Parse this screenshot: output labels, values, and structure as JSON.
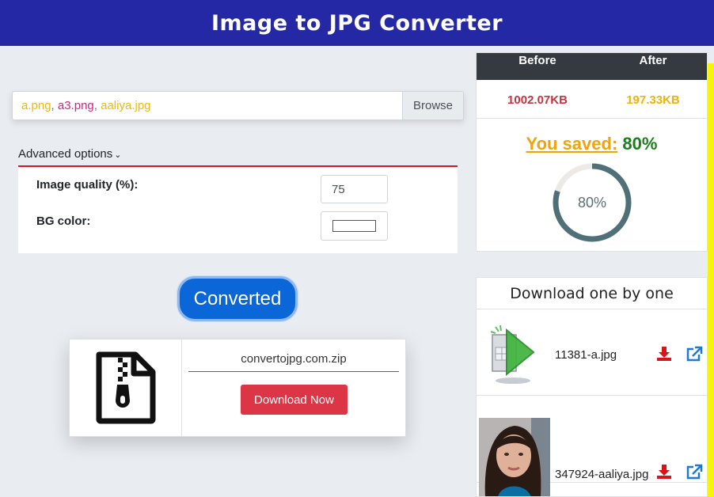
{
  "header": {
    "title": "Image to JPG Converter"
  },
  "upload": {
    "files": [
      "a.png",
      "a3.png",
      "aaliya.jpg"
    ],
    "separator": ", ",
    "browse_label": "Browse"
  },
  "advanced": {
    "toggle_label": "Advanced options",
    "quality_label": "Image quality (%):",
    "quality_value": "75",
    "bg_color_label": "BG color:",
    "bg_color_value": "#ffffff"
  },
  "status_button_label": "Converted",
  "zip": {
    "filename": "convertojpg.com.zip",
    "download_label": "Download Now",
    "icon": "zip-file-icon"
  },
  "stats": {
    "before_label": "Before",
    "after_label": "After",
    "before_value": "1002.07KB",
    "after_value": "197.33KB",
    "saved_label": "You saved:",
    "saved_value": "80%",
    "ring_percent": 80,
    "ring_text": "80%",
    "colors": {
      "ring": "#4f7078",
      "ring_track": "#ede9e7",
      "saved_label": "#f0a30a",
      "saved_value": "#1b7f1b"
    }
  },
  "download_list": {
    "title": "Download one by one",
    "items": [
      {
        "filename": "11381-a.jpg",
        "thumb": "convert-app-icon"
      },
      {
        "filename": "347924-aaliya.jpg",
        "thumb": "portrait-photo"
      }
    ]
  },
  "colors": {
    "header_bg": "#2428a4",
    "accent_blue": "#0b66d8",
    "danger": "#dc3545"
  }
}
